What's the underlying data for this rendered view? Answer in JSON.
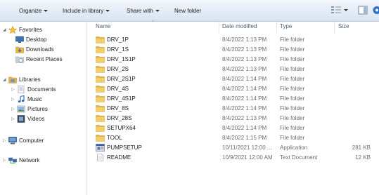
{
  "toolbar": {
    "organize": "Organize",
    "include_in_library": "Include in library",
    "share_with": "Share with",
    "new_folder": "New folder"
  },
  "nav": {
    "favorites": "Favorites",
    "desktop": "Desktop",
    "downloads": "Downloads",
    "recent_places": "Recent Places",
    "libraries": "Libraries",
    "documents": "Documents",
    "music": "Music",
    "pictures": "Pictures",
    "videos": "Videos",
    "computer": "Computer",
    "network": "Network"
  },
  "columns": {
    "name": "Name",
    "date_modified": "Date modified",
    "type": "Type",
    "size": "Size"
  },
  "files": [
    {
      "name": "DRV_1P",
      "date": "8/4/2022 1:13 PM",
      "type": "File folder",
      "size": "",
      "icon": "folder-icon"
    },
    {
      "name": "DRV_1S",
      "date": "8/4/2022 1:13 PM",
      "type": "File folder",
      "size": "",
      "icon": "folder-icon"
    },
    {
      "name": "DRV_1S1P",
      "date": "8/4/2022 1:13 PM",
      "type": "File folder",
      "size": "",
      "icon": "folder-icon"
    },
    {
      "name": "DRV_2S",
      "date": "8/4/2022 1:13 PM",
      "type": "File folder",
      "size": "",
      "icon": "folder-icon"
    },
    {
      "name": "DRV_2S1P",
      "date": "8/4/2022 1:14 PM",
      "type": "File folder",
      "size": "",
      "icon": "folder-icon"
    },
    {
      "name": "DRV_4S",
      "date": "8/4/2022 1:14 PM",
      "type": "File folder",
      "size": "",
      "icon": "folder-icon"
    },
    {
      "name": "DRV_4S1P",
      "date": "8/4/2022 1:14 PM",
      "type": "File folder",
      "size": "",
      "icon": "folder-icon"
    },
    {
      "name": "DRV_8S",
      "date": "8/4/2022 1:14 PM",
      "type": "File folder",
      "size": "",
      "icon": "folder-icon"
    },
    {
      "name": "DRV_28S",
      "date": "8/4/2022 1:13 PM",
      "type": "File folder",
      "size": "",
      "icon": "folder-icon"
    },
    {
      "name": "SETUPX64",
      "date": "8/4/2022 1:14 PM",
      "type": "File folder",
      "size": "",
      "icon": "folder-icon"
    },
    {
      "name": "TOOL",
      "date": "8/4/2022 1:15 PM",
      "type": "File folder",
      "size": "",
      "icon": "folder-icon"
    },
    {
      "name": "PUMPSETUP",
      "date": "10/11/2021 12:00 ...",
      "type": "Application",
      "size": "281 KB",
      "icon": "application-icon"
    },
    {
      "name": "README",
      "date": "10/9/2021 12:00 AM",
      "type": "Text Document",
      "size": "12 KB",
      "icon": "text-document-icon"
    }
  ]
}
